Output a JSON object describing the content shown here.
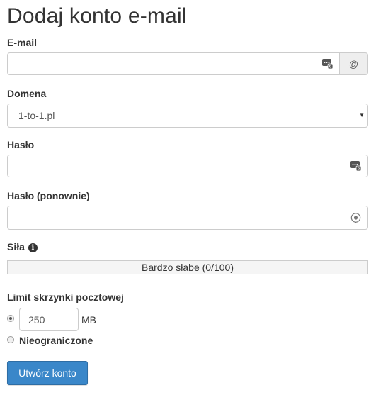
{
  "page": {
    "title": "Dodaj konto e-mail"
  },
  "email": {
    "label": "E-mail",
    "value": "",
    "addon": "@"
  },
  "domain": {
    "label": "Domena",
    "selected": "1-to-1.pl"
  },
  "password": {
    "label": "Hasło",
    "value": ""
  },
  "password_repeat": {
    "label": "Hasło (ponownie)",
    "value": ""
  },
  "strength": {
    "label": "Siła",
    "text": "Bardzo słabe (0/100)",
    "score": 0,
    "max": 100
  },
  "quota": {
    "label": "Limit skrzynki pocztowej",
    "value": "250",
    "unit": "MB",
    "unlimited_label": "Nieograniczone",
    "selected_option": "limited"
  },
  "submit": {
    "label": "Utwórz konto"
  },
  "colors": {
    "primary": "#3a87c9",
    "border": "#cccccc"
  },
  "icons": {
    "password_manager": "password-manager-icon",
    "reveal": "password-reveal-icon",
    "info": "info-icon"
  }
}
